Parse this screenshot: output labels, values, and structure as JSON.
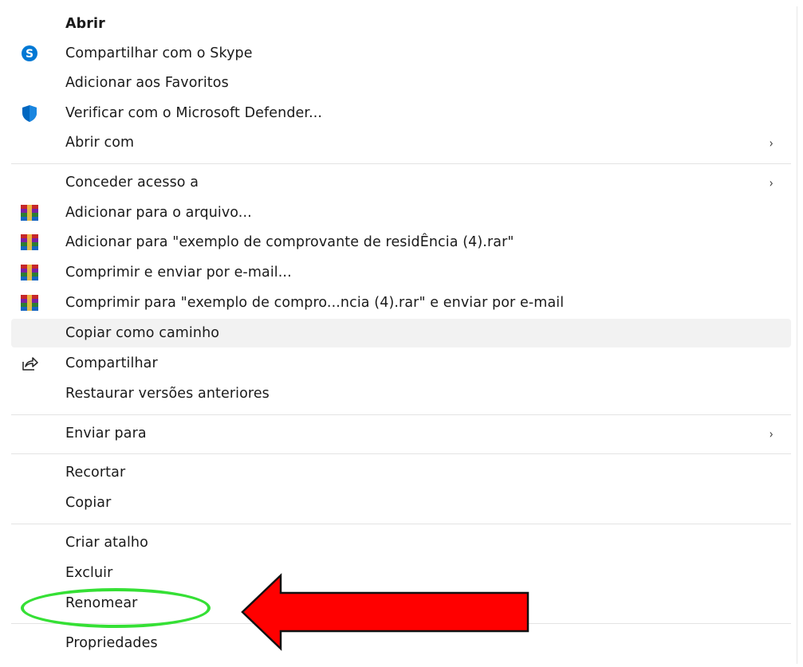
{
  "menu": {
    "items": [
      {
        "label": "Abrir",
        "bold": true,
        "icon": "",
        "submenu": false
      },
      {
        "label": "Compartilhar com o Skype",
        "icon": "skype-icon",
        "submenu": false
      },
      {
        "label": "Adicionar aos Favoritos",
        "icon": "",
        "submenu": false
      },
      {
        "label": "Verificar com o Microsoft Defender...",
        "icon": "defender-shield-icon",
        "submenu": false
      },
      {
        "label": "Abrir com",
        "icon": "",
        "submenu": true
      },
      {
        "label": "Conceder acesso a",
        "icon": "",
        "submenu": true
      },
      {
        "label": "Adicionar para o arquivo...",
        "icon": "winrar-icon",
        "submenu": false
      },
      {
        "label": "Adicionar para \"exemplo de comprovante de residÊncia (4).rar\"",
        "icon": "winrar-icon",
        "submenu": false
      },
      {
        "label": "Comprimir e enviar por e-mail...",
        "icon": "winrar-icon",
        "submenu": false
      },
      {
        "label": "Comprimir para \"exemplo de compro...ncia (4).rar\" e enviar por e-mail",
        "icon": "winrar-icon",
        "submenu": false
      },
      {
        "label": "Copiar como caminho",
        "icon": "",
        "submenu": false,
        "hovered": true
      },
      {
        "label": "Compartilhar",
        "icon": "share-icon",
        "submenu": false
      },
      {
        "label": "Restaurar versões anteriores",
        "icon": "",
        "submenu": false
      },
      {
        "label": "Enviar para",
        "icon": "",
        "submenu": true
      },
      {
        "label": "Recortar",
        "icon": "",
        "submenu": false
      },
      {
        "label": "Copiar",
        "icon": "",
        "submenu": false
      },
      {
        "label": "Criar atalho",
        "icon": "",
        "submenu": false
      },
      {
        "label": "Excluir",
        "icon": "",
        "submenu": false
      },
      {
        "label": "Renomear",
        "icon": "",
        "submenu": false,
        "highlighted": true
      },
      {
        "label": "Propriedades",
        "icon": "",
        "submenu": false
      }
    ],
    "chevron": "›"
  },
  "annotations": {
    "ellipse_color": "#35e035",
    "arrow_color": "#ff0000",
    "target_item": "Renomear"
  },
  "colors": {
    "skype": "#0078d4",
    "defender": "#0067c0",
    "hover": "#f2f2f2",
    "separator": "#e3e3e3"
  }
}
